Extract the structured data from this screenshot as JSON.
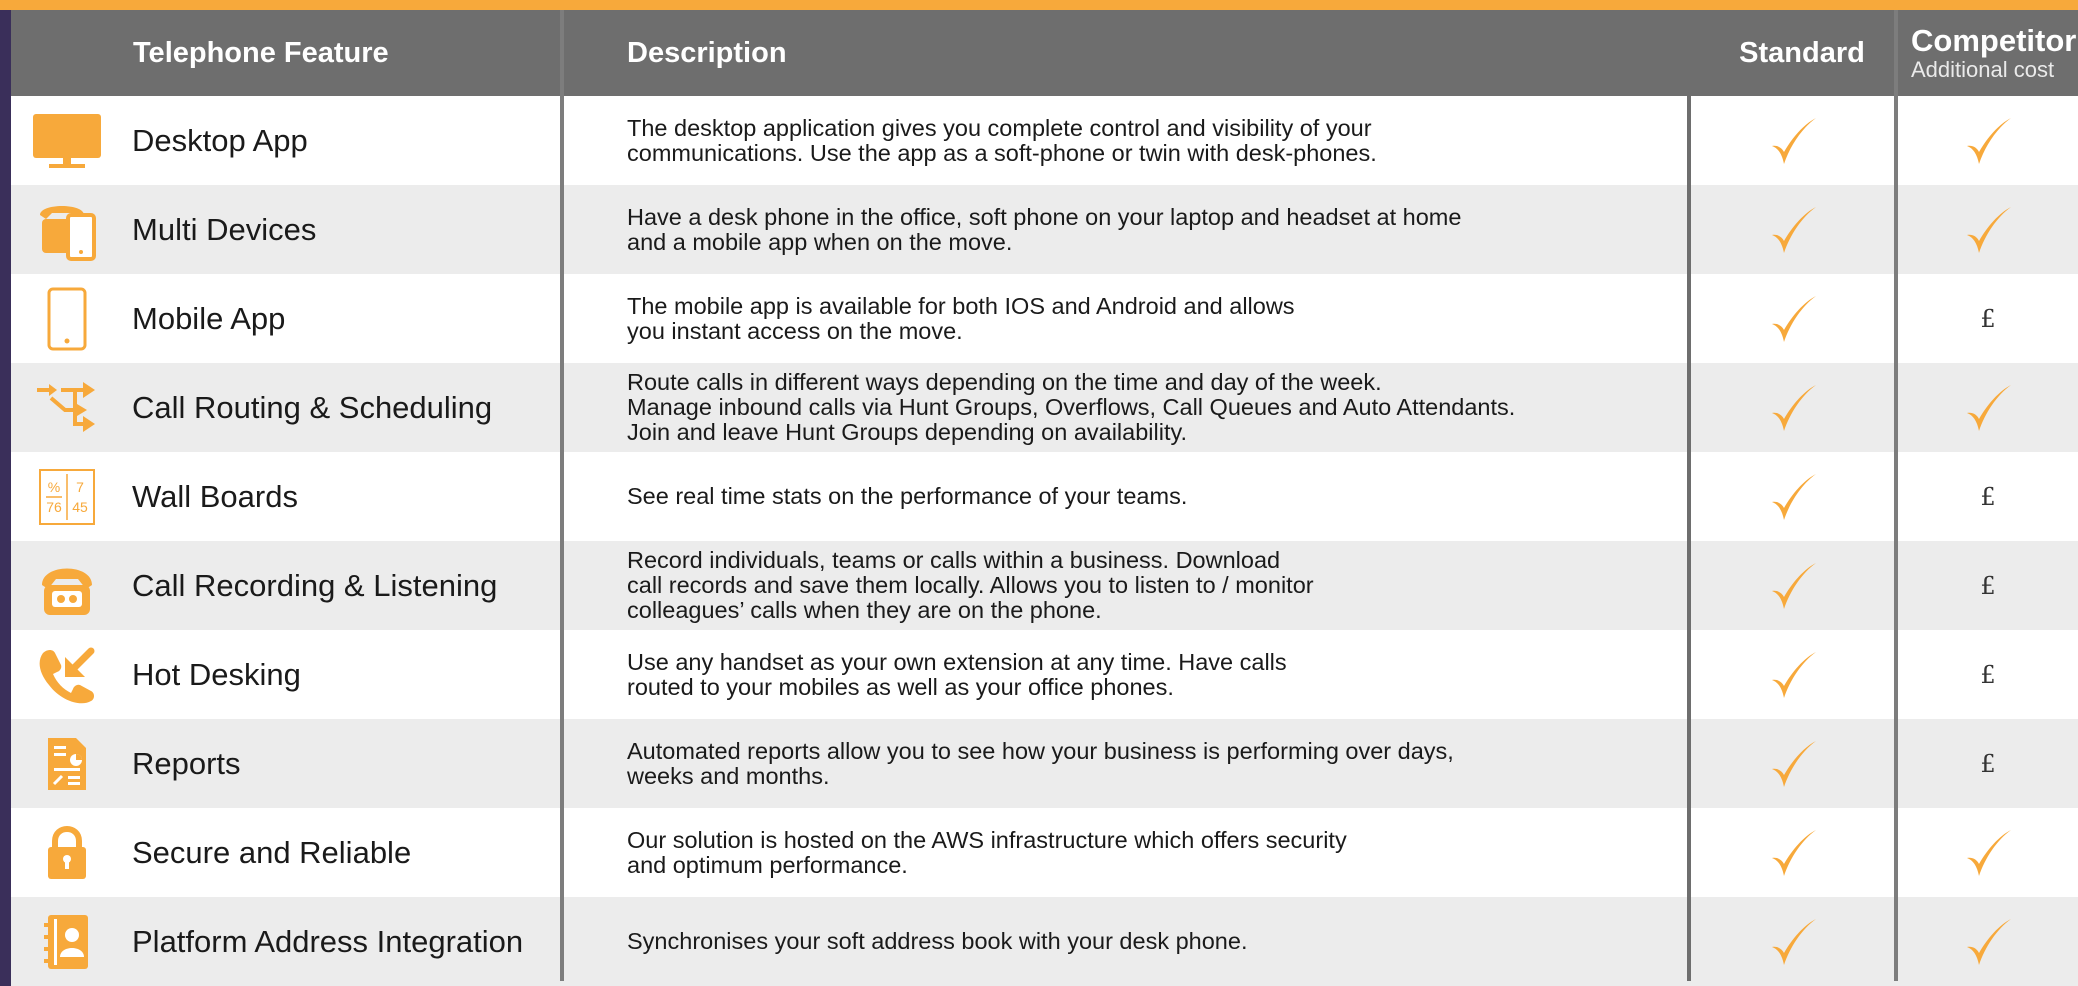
{
  "header": {
    "feature": "Telephone Feature",
    "description": "Description",
    "standard": "Standard",
    "competitor": "Competitor",
    "competitor_sub": "Additional cost"
  },
  "colors": {
    "accent": "#f7a93b",
    "header_bg": "#6e6e6e",
    "row_alt": "#ececec",
    "background": "#3a2f5a"
  },
  "rows": [
    {
      "icon": "monitor-icon",
      "feature": "Desktop App",
      "description": "The desktop application gives you complete control and visibility of your\ncommunications. Use the app as a soft-phone or twin with desk-phones.",
      "standard": "check",
      "competitor": "check"
    },
    {
      "icon": "multi-devices-icon",
      "feature": "Multi Devices",
      "description": "Have a desk phone in the office, soft phone on your laptop and headset at home\nand a mobile app when on the move.",
      "standard": "check",
      "competitor": "check"
    },
    {
      "icon": "mobile-phone-icon",
      "feature": "Mobile App",
      "description": "The mobile app is available for both IOS and Android and allows\nyou instant access on the move.",
      "standard": "check",
      "competitor": "£"
    },
    {
      "icon": "routing-arrows-icon",
      "feature": "Call Routing & Scheduling",
      "description": "Route calls in different ways depending on the time and day of the week.\nManage inbound calls via Hunt Groups, Overflows, Call Queues and Auto Attendants.\nJoin and leave Hunt Groups depending on availability.",
      "standard": "check",
      "competitor": "check"
    },
    {
      "icon": "wallboard-icon",
      "icon_text": [
        "%",
        "7",
        "76",
        "45"
      ],
      "feature": "Wall Boards",
      "description": "See real time stats on the performance of your teams.",
      "standard": "check",
      "competitor": "£"
    },
    {
      "icon": "call-recording-icon",
      "feature": "Call Recording & Listening",
      "description": "Record individuals, teams or calls within a business. Download\ncall records and save them locally. Allows you to listen to / monitor\ncolleagues’ calls when they are on the phone.",
      "standard": "check",
      "competitor": "£"
    },
    {
      "icon": "phone-incoming-icon",
      "feature": "Hot Desking",
      "description": "Use any handset as your own extension at any time. Have calls\nrouted to your mobiles as well as your office phones.",
      "standard": "check",
      "competitor": "£"
    },
    {
      "icon": "report-document-icon",
      "feature": "Reports",
      "description": "Automated reports allow you to see how your business is performing over days,\nweeks and months.",
      "standard": "check",
      "competitor": "£"
    },
    {
      "icon": "padlock-icon",
      "feature": "Secure and Reliable",
      "description": "Our solution is hosted on the AWS infrastructure which offers security\nand optimum performance.",
      "standard": "check",
      "competitor": "check"
    },
    {
      "icon": "address-book-icon",
      "feature": "Platform Address Integration",
      "description": "Synchronises your soft address book with your desk phone.",
      "standard": "check",
      "competitor": "check"
    }
  ]
}
